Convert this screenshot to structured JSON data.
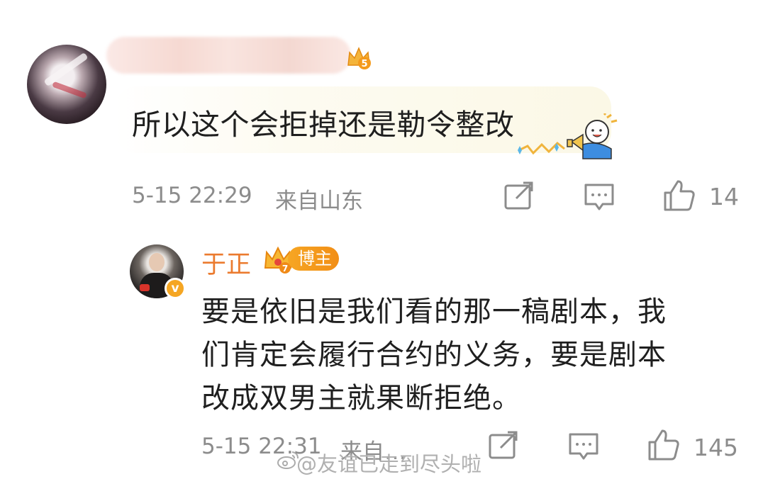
{
  "comment": {
    "text": "所以这个会拒掉还是勒令整改",
    "time": "5-15 22:29",
    "location": "来自山东",
    "like_count": "14",
    "fan_badge_level": "5"
  },
  "reply": {
    "author": "于正",
    "crown_level": "7",
    "tag": "博主",
    "verified_mark": "v",
    "text_lines": [
      "要是依旧是我们看的那一稿剧本，我",
      "们肯定会履行合约的义务，要是剧本",
      "改成双男主就果断拒绝。"
    ],
    "time": "5-15 22:31",
    "location": "来自…",
    "like_count": "145"
  },
  "watermark": {
    "text": "@友谊已走到尽头啦"
  },
  "colors": {
    "accent_orange": "#eb7b2f",
    "meta_gray": "#8c8c8c",
    "tag_orange": "#f6a623"
  },
  "icons": [
    "share-icon",
    "comment-icon",
    "like-icon",
    "verified-icon",
    "crown-icon",
    "weibo-logo-icon"
  ]
}
